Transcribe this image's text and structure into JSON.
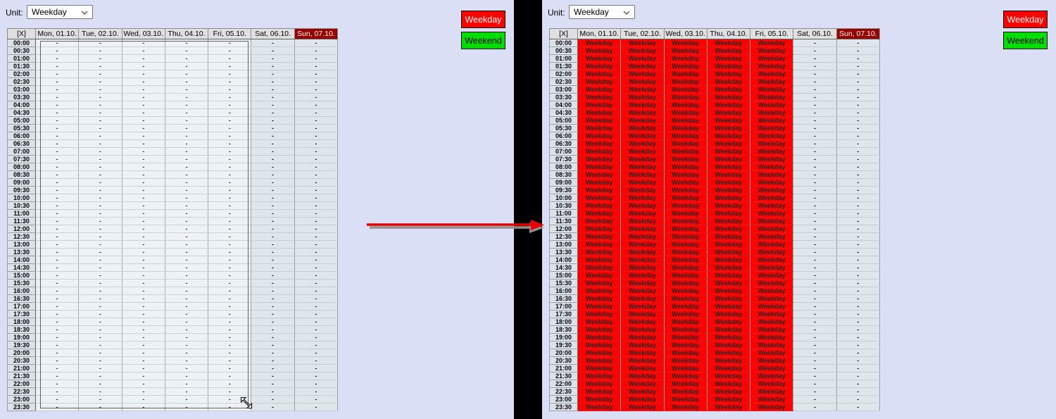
{
  "schedule": {
    "unit_label": "Unit:",
    "unit_value": "Weekday",
    "corner_label": "[X]",
    "columns": [
      {
        "label": "Mon, 01.10.",
        "type": "weekday"
      },
      {
        "label": "Tue, 02.10.",
        "type": "weekday"
      },
      {
        "label": "Wed, 03.10.",
        "type": "weekday"
      },
      {
        "label": "Thu, 04.10.",
        "type": "weekday"
      },
      {
        "label": "Fri, 05.10.",
        "type": "weekday"
      },
      {
        "label": "Sat, 06.10.",
        "type": "sat"
      },
      {
        "label": "Sun, 07.10.",
        "type": "sun"
      }
    ],
    "times": [
      "00:00",
      "00:30",
      "01:00",
      "01:30",
      "02:00",
      "02:30",
      "03:00",
      "03:30",
      "04:00",
      "04:30",
      "05:00",
      "05:30",
      "06:00",
      "06:30",
      "07:00",
      "07:30",
      "08:00",
      "08:30",
      "09:00",
      "09:30",
      "10:00",
      "10:30",
      "11:00",
      "11:30",
      "12:00",
      "12:30",
      "13:00",
      "13:30",
      "14:00",
      "14:30",
      "15:00",
      "15:30",
      "16:00",
      "16:30",
      "17:00",
      "17:30",
      "18:00",
      "18:30",
      "19:00",
      "19:30",
      "20:00",
      "20:30",
      "21:00",
      "21:30",
      "22:00",
      "22:30",
      "23:00",
      "23:30"
    ],
    "empty_cell": "-",
    "legend": [
      {
        "label": "Weekday",
        "bg": "#ff0000",
        "fg": "#ffffff"
      },
      {
        "label": "Weekend",
        "bg": "#00dd00",
        "fg": "#000000"
      }
    ]
  },
  "panels": [
    {
      "name": "before",
      "cell_default": "-",
      "light_columns": [
        0,
        1,
        2,
        3,
        4
      ],
      "fill": null
    },
    {
      "name": "after",
      "cell_default": "-",
      "light_columns": [],
      "fill": {
        "columns": [
          0,
          1,
          2,
          3,
          4
        ],
        "label": "Weekday"
      }
    }
  ],
  "colors": {
    "page_background": "#dbdff6",
    "filled_cell": "#ff0000",
    "sunday_header": "#990000",
    "weekday_button": "#ff0000",
    "weekend_button": "#00dd00",
    "arrow": "#e60000"
  }
}
